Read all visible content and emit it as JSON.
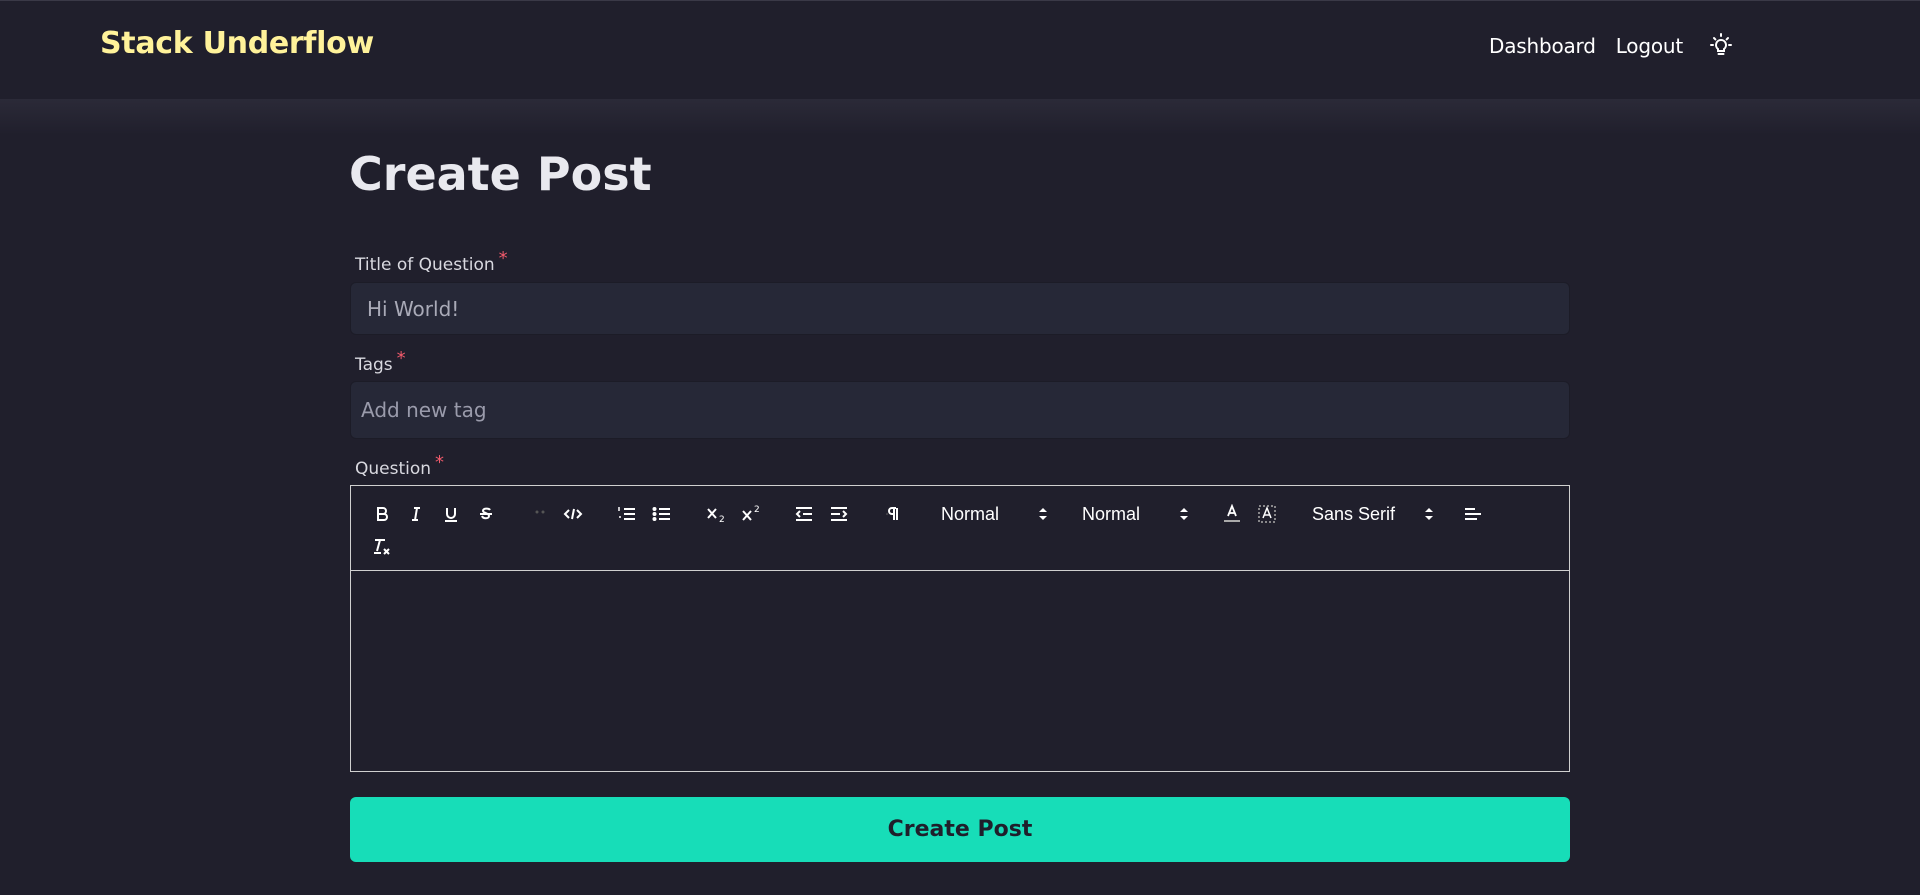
{
  "header": {
    "brand": "Stack Underflow",
    "nav": {
      "dashboard": "Dashboard",
      "logout": "Logout"
    },
    "theme_icon": "lightbulb-icon"
  },
  "main": {
    "title": "Create Post",
    "fields": {
      "title_label": "Title of Question",
      "title_value": "Hi World!",
      "tags_label": "Tags",
      "tags_placeholder": "Add new tag",
      "question_label": "Question",
      "required_mark": "*"
    },
    "editor": {
      "toolbar": {
        "tools": [
          "bold-icon",
          "italic-icon",
          "underline-icon",
          "strike-icon",
          "blockquote-icon",
          "code-block-icon",
          "ordered-list-icon",
          "bullet-list-icon",
          "subscript-icon",
          "superscript-icon",
          "outdent-icon",
          "indent-icon",
          "text-direction-icon",
          "font-color-icon",
          "background-color-icon",
          "align-icon",
          "clean-format-icon"
        ],
        "header_select": "Normal",
        "size_select": "Normal",
        "font_select": "Sans Serif"
      },
      "content": ""
    },
    "submit_label": "Create Post"
  },
  "colors": {
    "background": "#201f2c",
    "brand": "#fff29a",
    "accent": "#17ddb8",
    "required": "#f05a6b",
    "input_bg": "#262837"
  }
}
